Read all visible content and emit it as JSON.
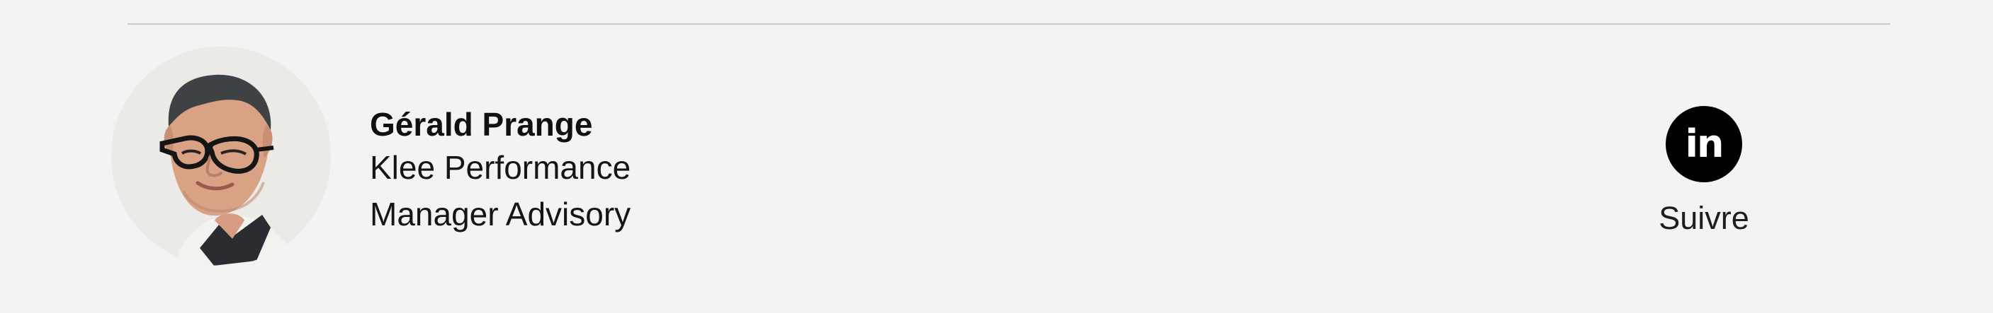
{
  "author": {
    "name": "Gérald Prange",
    "company": "Klee Performance",
    "role": "Manager Advisory"
  },
  "social": {
    "icon": "linkedin-icon",
    "icon_text": "in",
    "follow_label": "Suivre"
  },
  "colors": {
    "background": "#f4f3f4",
    "divider": "#c9c9c9",
    "text": "#151515",
    "icon_background": "#000000",
    "icon_text": "#ffffff"
  }
}
